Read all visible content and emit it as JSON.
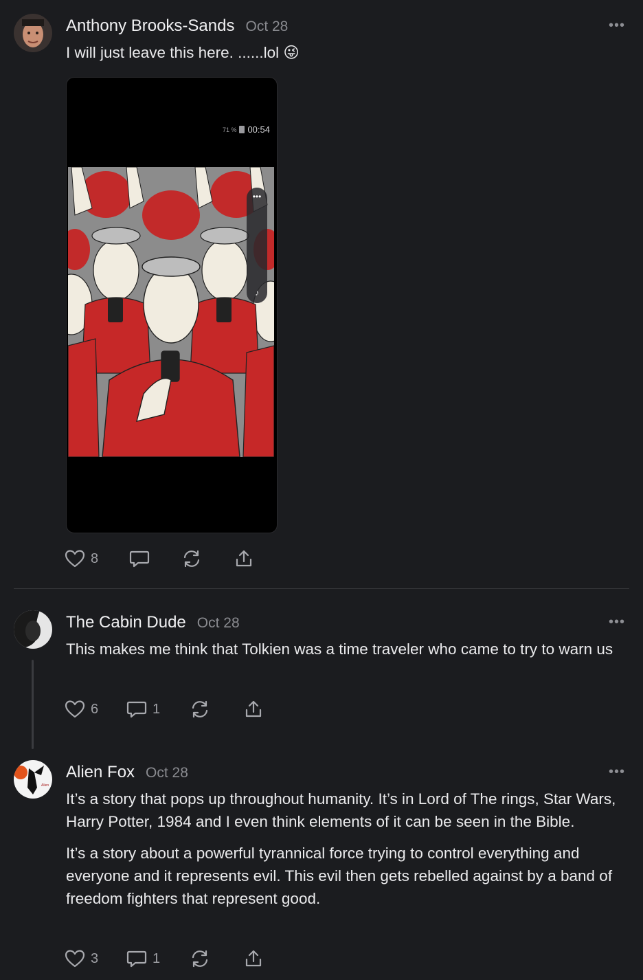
{
  "posts": [
    {
      "author": "Anthony Brooks-Sands",
      "date": "Oct 28",
      "text": [
        "I will just leave this here. ......lol 😜"
      ],
      "media": {
        "status_battery": "71 %",
        "status_time": "00:54"
      },
      "likes": "8",
      "comments": ""
    },
    {
      "author": "The Cabin Dude",
      "date": "Oct 28",
      "text": [
        "This makes me think that Tolkien was a time traveler who came to try to warn us"
      ],
      "likes": "6",
      "comments": "1"
    },
    {
      "author": "Alien Fox",
      "date": "Oct 28",
      "text": [
        "It’s a story that pops up throughout humanity. It’s in Lord of The rings, Star Wars, Harry Potter, 1984 and I even think elements of it can be seen in the Bible.",
        "It’s a story about a powerful tyrannical force trying to control everything and everyone and it represents evil. This evil then gets rebelled against by a band of freedom fighters that represent good."
      ],
      "likes": "3",
      "comments": "1"
    }
  ],
  "icons": {
    "more": "more-icon",
    "like": "heart-icon",
    "comment": "comment-icon",
    "restack": "restack-icon",
    "share": "share-icon"
  }
}
